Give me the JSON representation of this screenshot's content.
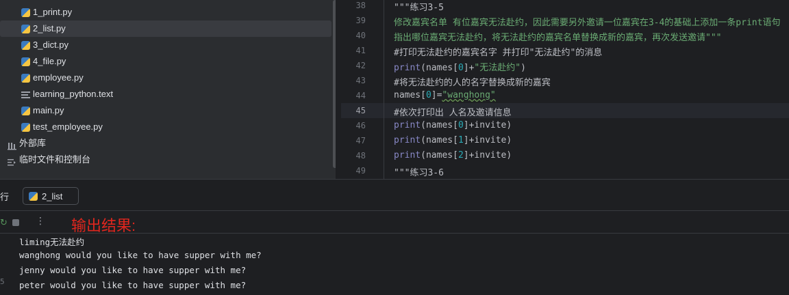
{
  "project_tree": {
    "items": [
      {
        "label": "1_print.py",
        "icon": "python-file-icon"
      },
      {
        "label": "2_list.py",
        "icon": "python-file-icon",
        "selected": true
      },
      {
        "label": "3_dict.py",
        "icon": "python-file-icon"
      },
      {
        "label": "4_file.py",
        "icon": "python-file-icon"
      },
      {
        "label": "employee.py",
        "icon": "python-file-icon"
      },
      {
        "label": "learning_python.text",
        "icon": "text-file-icon"
      },
      {
        "label": "main.py",
        "icon": "python-file-icon"
      },
      {
        "label": "test_employee.py",
        "icon": "python-file-icon"
      },
      {
        "label": "外部库",
        "icon": "library-icon"
      },
      {
        "label": "临时文件和控制台",
        "icon": "scratch-console-icon"
      }
    ]
  },
  "editor": {
    "current_line": "45",
    "lines": [
      {
        "num": "38",
        "text": "\"\"\"练习3-5"
      },
      {
        "num": "39",
        "text": "修改嘉宾名单 有位嘉宾无法赴约，因此需要另外邀请一位嘉宾在3-4的基础上添加一条print语句"
      },
      {
        "num": "40",
        "text": "指出哪位嘉宾无法赴约，将无法赴约的嘉宾名单替换成新的嘉宾，再次发送邀请\"\"\""
      },
      {
        "num": "41",
        "text": "#打印无法赴约的嘉宾名字 并打印\"无法赴约\"的消息"
      },
      {
        "num": "42",
        "text": "print(names[0]+\"无法赴约\")"
      },
      {
        "num": "43",
        "text": "#将无法赴约的人的名字替换成新的嘉宾"
      },
      {
        "num": "44",
        "text": "names[0]=\"wanghong\""
      },
      {
        "num": "45",
        "text": "#依次打印出 人名及邀请信息"
      },
      {
        "num": "46",
        "text": "print(names[0]+invite)"
      },
      {
        "num": "47",
        "text": "print(names[1]+invite)"
      },
      {
        "num": "48",
        "text": "print(names[2]+invite)"
      },
      {
        "num": "49",
        "text": "\"\"\"练习3-6"
      }
    ]
  },
  "run_panel": {
    "title": "行",
    "tab_label": "2_list",
    "annotation": "输出结果:",
    "output": [
      {
        "gutter": "",
        "text": "liming无法赴约"
      },
      {
        "gutter": "",
        "text": "wanghong would you like to have supper with me?"
      },
      {
        "gutter": "",
        "text": "jenny would you like to have supper with me?"
      },
      {
        "gutter": "5",
        "text": "peter would you like to have supper with me?"
      }
    ]
  },
  "colors": {
    "accent": "#e0261e",
    "string": "#6aab73",
    "comment": "#7a7e85",
    "builtin": "#8888c6",
    "number": "#2aacb8"
  }
}
